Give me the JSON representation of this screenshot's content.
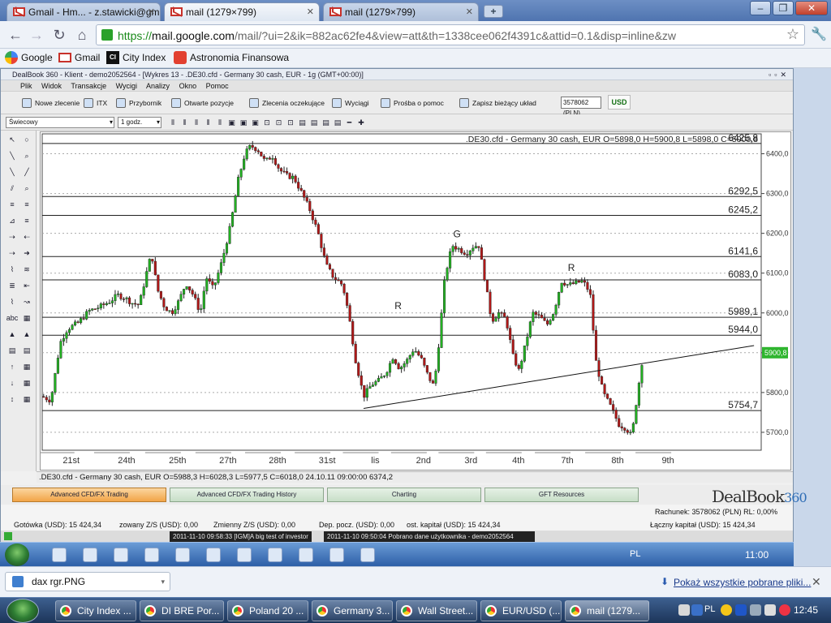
{
  "browser": {
    "tabs": [
      {
        "label": "Gmail - Hm... - z.stawicki@gm...",
        "active": false
      },
      {
        "label": "mail (1279×799)",
        "active": true
      },
      {
        "label": "mail (1279×799)",
        "active": false
      }
    ],
    "url": {
      "scheme": "https://",
      "domain": "mail.google.com",
      "path": "/mail/?ui=2&ik=882ac62fe4&view=att&th=1338cee062f4391c&attid=0.1&disp=inline&zw"
    },
    "bookmarks": [
      "Google",
      "Gmail",
      "City Index",
      "Astronomia Finansowa"
    ]
  },
  "app": {
    "title": "DealBook 360 - Klient - demo2052564 - [Wykres 13 - .DE30.cfd - Germany 30 cash, EUR - 1g (GMT+00:00)]",
    "menu": [
      "Plik",
      "Widok",
      "Transakcje",
      "Wycigi",
      "Analizy",
      "Okno",
      "Pomoc"
    ],
    "toolbar": [
      "Nowe zlecenie",
      "ITX",
      "Przybornik",
      "Otwarte pozycje",
      "Zlecenia oczekujące",
      "Wyciągi",
      "Prośba o pomoc",
      "Zapisz bieżący układ"
    ],
    "account_select": "3578062 (PLN)",
    "currency": "USD",
    "chart_type_select": "Świecowy",
    "interval_select": "1 godz.",
    "status_line": ".DE30.cfd - Germany 30 cash, EUR O=5988,3 H=6028,3 L=5977,5 C=6018,0   24.10.11 09:00:00 6374,2",
    "bottom_tabs": [
      "Advanced CFD/FX Trading",
      "Advanced CFD/FX Trading History",
      "Charting",
      "GFT Resources"
    ],
    "brand": {
      "text": "DealBook",
      "num": "360"
    },
    "account": {
      "rachunek": "Rachunek: 3578062 (PLN) RL: 0,00%",
      "gotowka": "Gotówka (USD): 15 424,34",
      "zowany": "zowany Z/S (USD): 0,00",
      "zmienny": "Zmienny Z/S (USD): 0,00",
      "dep": "Dep. pocz. (USD): 0,00",
      "kapital": "ost. kapitał (USD): 15 424,34",
      "laczny": "Łączny kapitał  (USD): 15 424,34"
    },
    "messages": [
      "2011-11-10 09:58:33 [IGM]A big test of investor",
      "2011-11-10 09:50:04 Pobrano dane użytkownika - demo2052564"
    ],
    "inner_clock": "11:00",
    "inner_lang": "PL"
  },
  "download": {
    "file": "dax rgr.PNG",
    "show_all": "Pokaż wszystkie pobrane pliki..."
  },
  "taskbar": {
    "tasks": [
      "City Index ...",
      "DI BRE Por...",
      "Poland 20 ...",
      "Germany 3...",
      "Wall Street...",
      "EUR/USD (...",
      "mail (1279..."
    ],
    "lang": "PL",
    "clock": "12:45"
  },
  "chart_data": {
    "type": "candlestick",
    "title": ".DE30.cfd - Germany 30 cash, EUR O=5898,0 H=5900,8 L=5898,0 C=5900,8",
    "y_ticks": [
      5700.0,
      5800.0,
      5900.0,
      6000.0,
      6100.0,
      6200.0,
      6300.0,
      6400.0
    ],
    "y_tick_labels": [
      "5700,0",
      "5800,0",
      "5900,0",
      "6000,0",
      "6100,0",
      "6200,0",
      "6300,0",
      "6400,0"
    ],
    "ylim": [
      5655,
      6450
    ],
    "x_tick_labels": [
      "21st",
      "24th",
      "25th",
      "27th",
      "28th",
      "31st",
      "lis",
      "2nd",
      "3rd",
      "4th",
      "7th",
      "8th",
      "9th"
    ],
    "current_price": "5900,8",
    "levels": [
      {
        "value": 6425.8,
        "label": "6425,8"
      },
      {
        "value": 6292.5,
        "label": "6292,5"
      },
      {
        "value": 6245.2,
        "label": "6245,2"
      },
      {
        "value": 6141.6,
        "label": "6141,6"
      },
      {
        "value": 6083.0,
        "label": "6083,0"
      },
      {
        "value": 5989.1,
        "label": "5989,1"
      },
      {
        "value": 5944.0,
        "label": "5944,0"
      },
      {
        "value": 5754.7,
        "label": "5754,7"
      }
    ],
    "annotations": [
      {
        "text": "R",
        "x": 0.495,
        "y": 6010
      },
      {
        "text": "G",
        "x": 0.577,
        "y": 6190
      },
      {
        "text": "R",
        "x": 0.736,
        "y": 6105
      }
    ],
    "trendline": {
      "x0": 0.447,
      "y0": 5760,
      "x1": 0.99,
      "y1": 5918
    },
    "close_path": [
      [
        0.0,
        5790
      ],
      [
        0.012,
        5780
      ],
      [
        0.025,
        5925
      ],
      [
        0.035,
        5960
      ],
      [
        0.05,
        5975
      ],
      [
        0.065,
        6005
      ],
      [
        0.08,
        6015
      ],
      [
        0.095,
        6030
      ],
      [
        0.105,
        6045
      ],
      [
        0.115,
        6038
      ],
      [
        0.125,
        6025
      ],
      [
        0.135,
        6020
      ],
      [
        0.145,
        6100
      ],
      [
        0.152,
        6150
      ],
      [
        0.16,
        6060
      ],
      [
        0.17,
        6015
      ],
      [
        0.18,
        6000
      ],
      [
        0.19,
        6030
      ],
      [
        0.2,
        6075
      ],
      [
        0.21,
        6045
      ],
      [
        0.22,
        6000
      ],
      [
        0.228,
        6090
      ],
      [
        0.238,
        6060
      ],
      [
        0.25,
        6130
      ],
      [
        0.262,
        6220
      ],
      [
        0.272,
        6330
      ],
      [
        0.282,
        6400
      ],
      [
        0.29,
        6420
      ],
      [
        0.3,
        6410
      ],
      [
        0.31,
        6380
      ],
      [
        0.32,
        6395
      ],
      [
        0.33,
        6360
      ],
      [
        0.34,
        6345
      ],
      [
        0.35,
        6340
      ],
      [
        0.36,
        6305
      ],
      [
        0.372,
        6260
      ],
      [
        0.383,
        6205
      ],
      [
        0.395,
        6120
      ],
      [
        0.405,
        6090
      ],
      [
        0.418,
        6070
      ],
      [
        0.426,
        6000
      ],
      [
        0.436,
        5880
      ],
      [
        0.447,
        5790
      ],
      [
        0.458,
        5820
      ],
      [
        0.468,
        5830
      ],
      [
        0.478,
        5850
      ],
      [
        0.488,
        5890
      ],
      [
        0.497,
        5860
      ],
      [
        0.507,
        5880
      ],
      [
        0.517,
        5910
      ],
      [
        0.527,
        5885
      ],
      [
        0.537,
        5840
      ],
      [
        0.545,
        5815
      ],
      [
        0.552,
        5930
      ],
      [
        0.56,
        6090
      ],
      [
        0.57,
        6170
      ],
      [
        0.58,
        6160
      ],
      [
        0.59,
        6150
      ],
      [
        0.6,
        6168
      ],
      [
        0.607,
        6170
      ],
      [
        0.615,
        6090
      ],
      [
        0.625,
        5980
      ],
      [
        0.635,
        6000
      ],
      [
        0.645,
        5985
      ],
      [
        0.655,
        5890
      ],
      [
        0.663,
        5855
      ],
      [
        0.672,
        5920
      ],
      [
        0.682,
        6000
      ],
      [
        0.692,
        5990
      ],
      [
        0.702,
        5970
      ],
      [
        0.712,
        6005
      ],
      [
        0.722,
        6080
      ],
      [
        0.732,
        6070
      ],
      [
        0.742,
        6075
      ],
      [
        0.752,
        6080
      ],
      [
        0.762,
        6050
      ],
      [
        0.77,
        5880
      ],
      [
        0.78,
        5800
      ],
      [
        0.792,
        5760
      ],
      [
        0.802,
        5720
      ],
      [
        0.812,
        5710
      ],
      [
        0.82,
        5690
      ],
      [
        0.828,
        5800
      ],
      [
        0.836,
        5900
      ]
    ]
  }
}
